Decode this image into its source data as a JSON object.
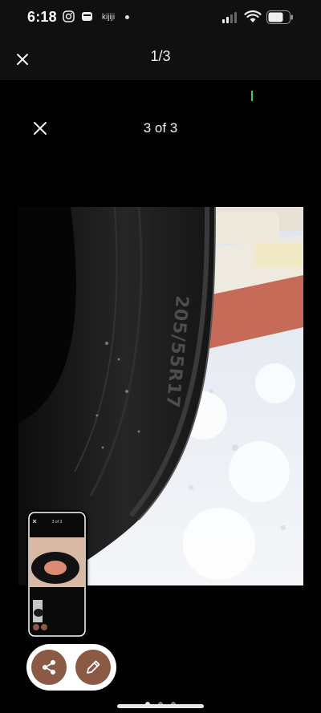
{
  "status_bar": {
    "time": "6:18",
    "app_label": "kijiji",
    "icons": [
      "instagram-icon",
      "wallet-icon",
      "notification-dot-icon",
      "signal-icon",
      "wifi-icon",
      "battery-icon"
    ]
  },
  "viewer": {
    "counter": "1/3",
    "close_icon": "close-icon"
  },
  "gallery": {
    "counter": "3 of 3",
    "close_icon": "close-icon",
    "current_page": 1,
    "total_pages": 3
  },
  "photo": {
    "subject": "tire-photo",
    "sidewall_text": "205/55R17"
  },
  "thumbnail": {
    "counter": "3 of 3"
  },
  "actions": {
    "share_icon": "share-icon",
    "edit_icon": "pencil-icon"
  },
  "colors": {
    "background": "#000000",
    "header_background": "#101010",
    "action_button": "#8a5a44",
    "accent_green": "#2ecc71"
  }
}
